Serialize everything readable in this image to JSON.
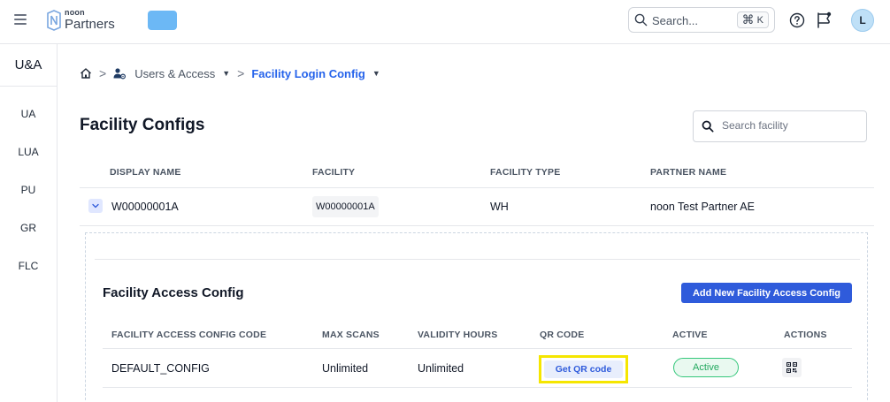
{
  "header": {
    "logo_small": "noon",
    "logo_big": "Partners",
    "search_placeholder": "Search...",
    "shortcut_symbol": "⌘",
    "shortcut_key": "K",
    "avatar_initial": "L",
    "accent_color": "#2f5bdb",
    "chip_color": "#6cb8f5"
  },
  "sidebar": {
    "title": "U&A",
    "items": [
      {
        "label": "UA"
      },
      {
        "label": "LUA"
      },
      {
        "label": "PU"
      },
      {
        "label": "GR"
      },
      {
        "label": "FLC"
      }
    ]
  },
  "breadcrumb": {
    "section": "Users & Access",
    "current": "Facility Login Config"
  },
  "page": {
    "title": "Facility Configs",
    "search_placeholder": "Search facility"
  },
  "facility_table": {
    "columns": [
      "DISPLAY NAME",
      "FACILITY",
      "FACILITY TYPE",
      "PARTNER NAME"
    ],
    "rows": [
      {
        "display_name": "W00000001A",
        "facility": "W00000001A",
        "facility_type": "WH",
        "partner_name": "noon Test Partner AE"
      }
    ]
  },
  "access_config": {
    "title": "Facility Access Config",
    "add_button": "Add New Facility Access Config",
    "columns": [
      "FACILITY ACCESS CONFIG CODE",
      "MAX SCANS",
      "VALIDITY HOURS",
      "QR CODE",
      "ACTIVE",
      "ACTIONS"
    ],
    "rows": [
      {
        "code": "DEFAULT_CONFIG",
        "max_scans": "Unlimited",
        "validity_hours": "Unlimited",
        "qr_button": "Get QR code",
        "status": "Active"
      }
    ],
    "highlight_color": "#f5e600",
    "status_color": "#22a85e"
  }
}
